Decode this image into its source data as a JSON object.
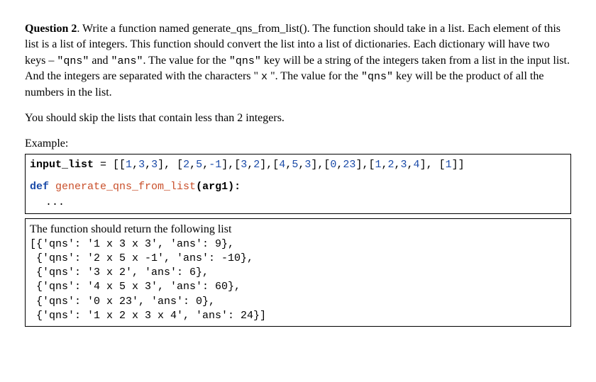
{
  "heading": {
    "label": "Question 2",
    "text": ". Write a function named generate_qns_from_list(). The function should take in a list. Each element of this list is a list of integers. This function should convert the list into a list of dictionaries. Each dictionary will have two keys – ",
    "code1": "\"qns\"",
    "mid1": " and ",
    "code2": "\"ans\"",
    "mid2": ". The value for the ",
    "code3": "\"qns\"",
    "mid3": " key will be a string of the integers taken from a list in the input list. And the integers are separated with the characters \" ",
    "code4": "x",
    "mid4": " \". The value for the ",
    "code5": "\"qns\"",
    "end": " key will be the product of all the numbers in the list."
  },
  "para2": "You should skip the lists that contain less than 2 integers.",
  "example_label": "Example:",
  "code": {
    "var": "input_list",
    "eq": " = ",
    "list_open": "[[",
    "n1": "1",
    "c": ",",
    "n2": "3",
    "n3": "3",
    "seg1": "], [",
    "n4": "2",
    "n5": "5",
    "n6": "-1",
    "seg2": "],[",
    "n7": "3",
    "n8": "2",
    "n9": "4",
    "n10": "5",
    "n11": "3",
    "n12": "0",
    "n13": "23",
    "n14": "1",
    "n15": "2",
    "n16": "3",
    "n17": "4",
    "seg3": "], [",
    "n18": "1",
    "list_close": "]]",
    "def_kw": "def",
    "fn": " generate_qns_from_list",
    "args": "(arg1):",
    "ellipsis": "..."
  },
  "output": {
    "intro": "The function should return the following list",
    "l1": "[{'qns': '1 x 3 x 3', 'ans': 9},",
    "l2": " {'qns': '2 x 5 x -1', 'ans': -10},",
    "l3": " {'qns': '3 x 2', 'ans': 6},",
    "l4": " {'qns': '4 x 5 x 3', 'ans': 60},",
    "l5": " {'qns': '0 x 23', 'ans': 0},",
    "l6": " {'qns': '1 x 2 x 3 x 4', 'ans': 24}]"
  }
}
